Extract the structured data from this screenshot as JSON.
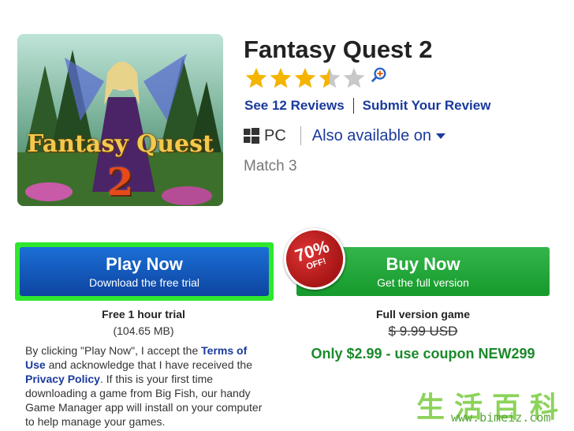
{
  "game": {
    "title": "Fantasy Quest 2",
    "cover_title_line1": "Fantasy Quest",
    "cover_title_line2": "2",
    "rating_stars": 3.5,
    "rating_max": 5,
    "see_reviews": "See 12 Reviews",
    "submit_review": "Submit Your Review",
    "platform": "PC",
    "also_available": "Also available on",
    "genre": "Match 3"
  },
  "play": {
    "main": "Play Now",
    "sub": "Download the free trial",
    "trial_heading": "Free 1 hour trial",
    "trial_size": "(104.65 MB)",
    "legal_1": "By clicking \"Play Now\", I accept the ",
    "terms_link": "Terms of Use",
    "legal_2": " and acknowledge that I have received the ",
    "privacy_link": "Privacy Policy",
    "legal_3": ". If this is your first time downloading a game from Big Fish, our handy Game Manager app will install on your computer to help manage your games."
  },
  "buy": {
    "main": "Buy Now",
    "sub": "Get the full version",
    "badge_pct": "70%",
    "badge_off": "OFF!",
    "full_heading": "Full version game",
    "old_price": "$ 9.99 USD",
    "promo": "Only $2.99 - use coupon NEW299"
  },
  "watermark": {
    "chinese": "生活百科",
    "url": "www.bimeiz.com"
  },
  "colors": {
    "link": "#1a3a9c",
    "star_filled": "#f4b400",
    "star_empty": "#c8c8c8",
    "play_blue": "#0d44a0",
    "buy_green": "#169a2c",
    "highlight_green": "#2ee82e"
  },
  "icons": {
    "platform": "windows-icon",
    "zoom": "zoom-in-icon",
    "dropdown": "chevron-down-icon"
  }
}
